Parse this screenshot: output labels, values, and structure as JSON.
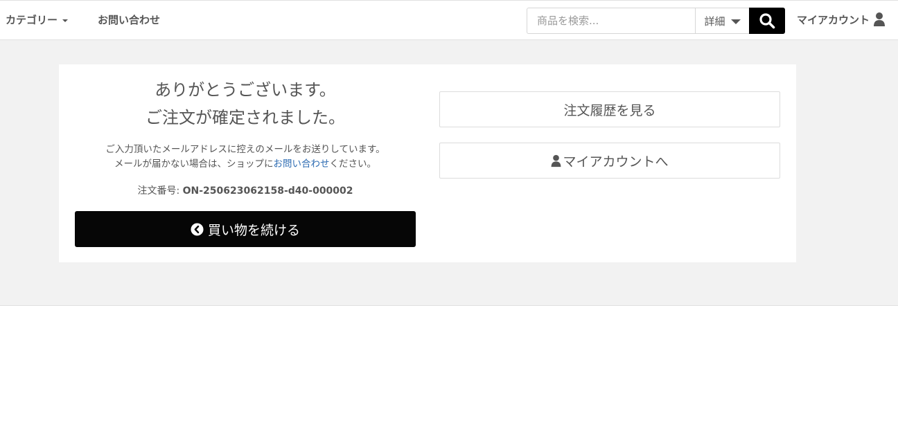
{
  "header": {
    "category_label": "カテゴリー",
    "contact_label": "お問い合わせ",
    "search_placeholder": "商品を検索...",
    "detail_label": "詳細",
    "myaccount_label": "マイアカウント"
  },
  "main": {
    "thanks_line1": "ありがとうございます。",
    "thanks_line2": "ご注文が確定されました。",
    "mail_note_line1": "ご入力頂いたメールアドレスに控えのメールをお送りしています。",
    "mail_note_line2_pre": "メールが届かない場合は、ショップに",
    "mail_note_link": "お問い合わせ",
    "mail_note_line2_post": "ください。",
    "order_no_label": "注文番号: ",
    "order_no_value": "ON-250623062158-d40-000002",
    "continue_label": "買い物を続ける",
    "history_label": "注文履歴を見る",
    "account_label": "マイアカウントへ"
  },
  "colors": {
    "accent_black": "#060606",
    "link_blue": "#2f6db3",
    "background_gray": "#f2f2f2"
  },
  "icons": [
    "chevron-down-icon",
    "search-icon",
    "user-icon",
    "chevron-left-circle-icon"
  ]
}
